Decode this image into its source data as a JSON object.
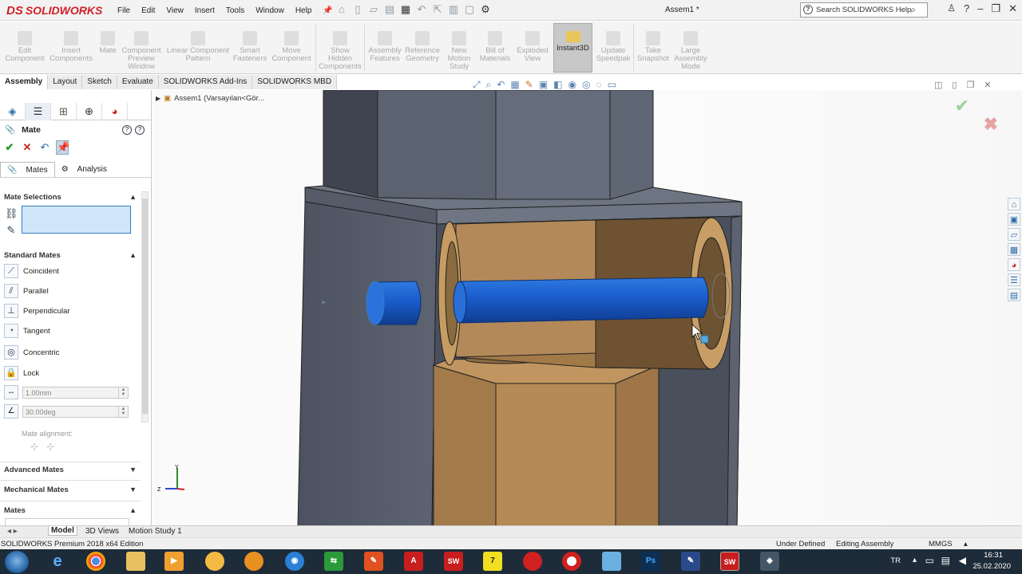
{
  "app": {
    "logo_text": "SOLIDWORKS",
    "logo_mark": "DS",
    "menu": [
      "File",
      "Edit",
      "View",
      "Insert",
      "Tools",
      "Window",
      "Help"
    ],
    "document_title": "Assem1 *",
    "search_placeholder": "Search SOLIDWORKS Help"
  },
  "ribbon": [
    {
      "label": "Edit\nComponent"
    },
    {
      "label": "Insert\nComponents"
    },
    {
      "label": "Mate"
    },
    {
      "label": "Component\nPreview\nWindow"
    },
    {
      "label": "Linear Component\nPattern"
    },
    {
      "label": "Smart\nFasteners"
    },
    {
      "label": "Move\nComponent"
    },
    {
      "label": "Show\nHidden\nComponents"
    },
    {
      "label": "Assembly\nFeatures"
    },
    {
      "label": "Reference\nGeometry"
    },
    {
      "label": "New\nMotion\nStudy"
    },
    {
      "label": "Bill of\nMaterials"
    },
    {
      "label": "Exploded\nView"
    },
    {
      "label": "Instant3D"
    },
    {
      "label": "Update\nSpeedpak"
    },
    {
      "label": "Take\nSnapshot"
    },
    {
      "label": "Large\nAssembly\nMode"
    }
  ],
  "tabs": [
    "Assembly",
    "Layout",
    "Sketch",
    "Evaluate",
    "SOLIDWORKS Add-Ins",
    "SOLIDWORKS MBD"
  ],
  "panel": {
    "title": "Mate",
    "subtabs": [
      "Mates",
      "Analysis"
    ],
    "mate_selections_label": "Mate Selections",
    "standard_mates_label": "Standard Mates",
    "mates": [
      "Coincident",
      "Parallel",
      "Perpendicular",
      "Tangent",
      "Concentric",
      "Lock"
    ],
    "distance_value": "1.00mm",
    "angle_value": "30.00deg",
    "mate_alignment_label": "Mate alignment:",
    "advanced_mates_label": "Advanced Mates",
    "mechanical_mates_label": "Mechanical Mates",
    "mates_section_label": "Mates"
  },
  "tree": {
    "root": "Assem1 (Varsayılan<Gör..."
  },
  "triad": {
    "y": "Y",
    "z": "Z"
  },
  "bottom_tabs": [
    "Model",
    "3D Views",
    "Motion Study 1"
  ],
  "status": {
    "edition": "SOLIDWORKS Premium 2018 x64 Edition",
    "state": "Under Defined",
    "mode": "Editing Assembly",
    "units": "MMGS"
  },
  "taskbar": {
    "lang": "TR",
    "time": "16:31",
    "date": "25.02.2020"
  },
  "colors": {
    "brand": "#d02027",
    "shaft": "#1f5fbf",
    "bracket": "#5e6470",
    "wood": "#b88a4e"
  }
}
